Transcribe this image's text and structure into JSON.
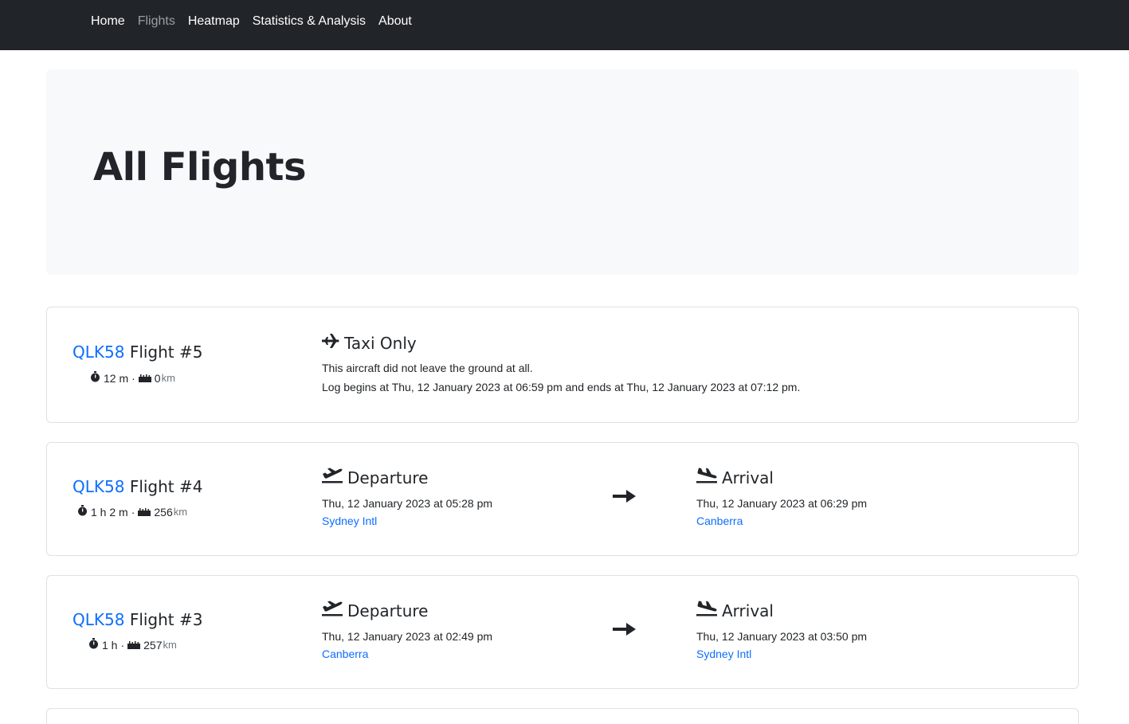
{
  "nav": {
    "items": [
      {
        "label": "Home"
      },
      {
        "label": "Flights"
      },
      {
        "label": "Heatmap"
      },
      {
        "label": "Statistics & Analysis"
      },
      {
        "label": "About"
      }
    ],
    "active": "Flights"
  },
  "page": {
    "title": "All Flights"
  },
  "flights": [
    {
      "callsign": "QLK58",
      "flight_label": "Flight #5",
      "duration": "12 m",
      "distance": "0",
      "distance_unit": "km",
      "type": "taxi",
      "heading": "Taxi Only",
      "line1": "This aircraft did not leave the ground at all.",
      "line2": "Log begins at Thu, 12 January 2023 at 06:59 pm and ends at Thu, 12 January 2023 at 07:12 pm."
    },
    {
      "callsign": "QLK58",
      "flight_label": "Flight #4",
      "duration": "1 h 2 m",
      "distance": "256",
      "distance_unit": "km",
      "departure_heading": "Departure",
      "departure_time": "Thu, 12 January 2023 at 05:28 pm",
      "departure_airport": "Sydney Intl",
      "arrival_heading": "Arrival",
      "arrival_time": "Thu, 12 January 2023 at 06:29 pm",
      "arrival_airport": "Canberra"
    },
    {
      "callsign": "QLK58",
      "flight_label": "Flight #3",
      "duration": "1 h",
      "distance": "257",
      "distance_unit": "km",
      "departure_heading": "Departure",
      "departure_time": "Thu, 12 January 2023 at 02:49 pm",
      "departure_airport": "Canberra",
      "arrival_heading": "Arrival",
      "arrival_time": "Thu, 12 January 2023 at 03:50 pm",
      "arrival_airport": "Sydney Intl"
    }
  ],
  "icons": {
    "duration": "stopwatch-icon",
    "distance": "ruler-icon",
    "taxi": "plane-icon",
    "departure": "plane-departure-icon",
    "arrival": "plane-arrival-icon",
    "route_arrow": "arrow-right-icon"
  },
  "colors": {
    "navbar": "#212529",
    "link": "#0d6efd",
    "jumbotron": "#f8f9fa"
  }
}
